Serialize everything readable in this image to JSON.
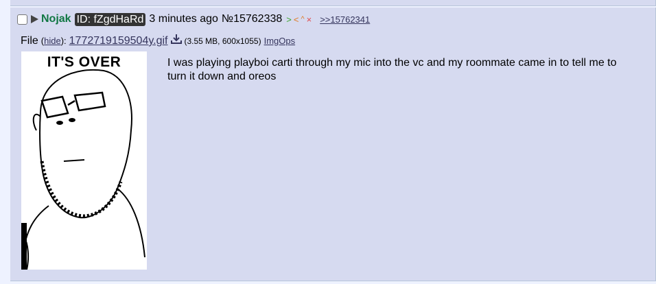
{
  "post": {
    "name": "Nojak",
    "poster_id": "ID: fZgdHaRd",
    "date": "3 minutes ago",
    "number": "№15762338",
    "controls": {
      "reply_arrow": ">",
      "back_arrow": "<",
      "caret": "^",
      "close": "×"
    },
    "backlink": ">>15762341",
    "message": "I was playing playboi carti through my mic into the vc and my roommate came in to tell me to turn it down and oreos"
  },
  "file": {
    "label": "File",
    "hide_label": "hide",
    "filename": "1772719159504y.gif",
    "meta": "(3.55 MB, 600x1055)",
    "imgops_label": "ImgOps",
    "thumb_text": "IT'S OVER"
  },
  "colors": {
    "post_bg": "#d6daf0",
    "page_bg": "#eef2ff",
    "name": "#117743",
    "link": "#34345c"
  }
}
